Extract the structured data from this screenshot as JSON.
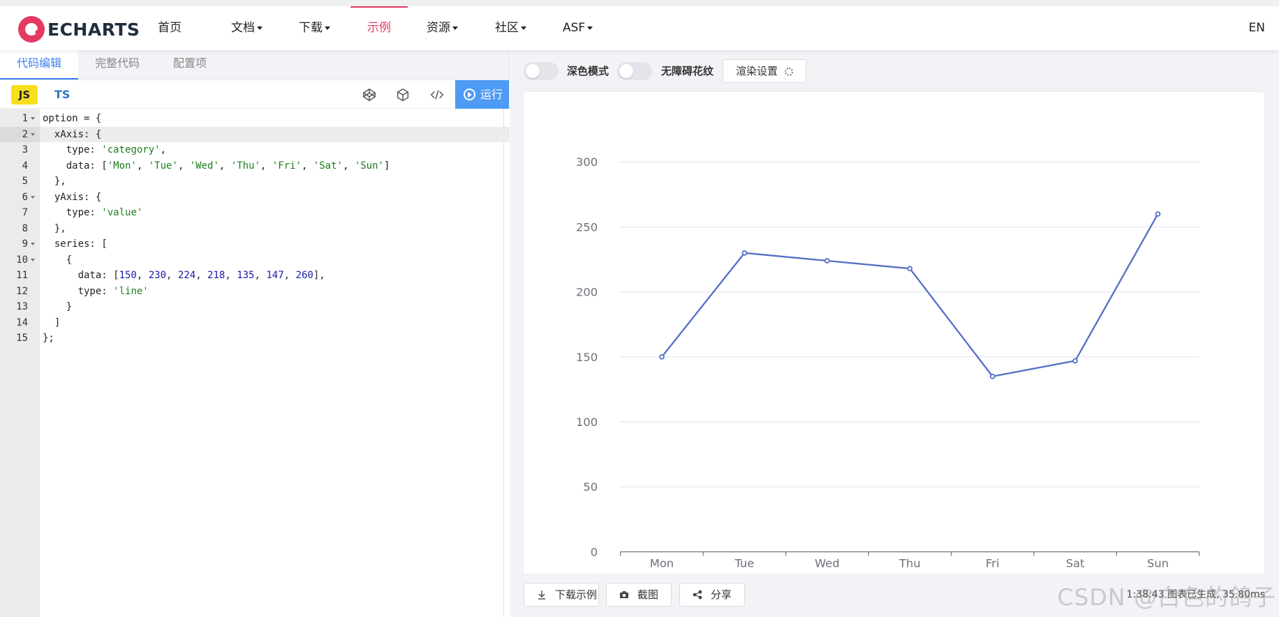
{
  "nav": {
    "logo_text": "ECHARTS",
    "items": [
      {
        "label": "首页",
        "dropdown": false,
        "active": false
      },
      {
        "label": "文档",
        "dropdown": true,
        "active": false
      },
      {
        "label": "下载",
        "dropdown": true,
        "active": false
      },
      {
        "label": "示例",
        "dropdown": false,
        "active": true
      },
      {
        "label": "资源",
        "dropdown": true,
        "active": false
      },
      {
        "label": "社区",
        "dropdown": true,
        "active": false
      },
      {
        "label": "ASF",
        "dropdown": true,
        "active": false
      }
    ],
    "lang": "EN",
    "accent_color": "#e43961"
  },
  "editor": {
    "tabs": [
      "代码编辑",
      "完整代码",
      "配置项"
    ],
    "active_tab": 0,
    "js_label": "JS",
    "ts_label": "TS",
    "tool_icons": [
      "codepen-icon",
      "codesandbox-icon",
      "embed-code-icon"
    ],
    "run_label": "运行",
    "current_line": 2,
    "lines": [
      {
        "n": "1",
        "fold": true,
        "html": "option = {"
      },
      {
        "n": "2",
        "fold": true,
        "html": "  xAxis: {"
      },
      {
        "n": "3",
        "fold": false,
        "html": "    type: <span class=\"s\">'category'</span>,"
      },
      {
        "n": "4",
        "fold": false,
        "html": "    data: [<span class=\"s\">'Mon'</span>, <span class=\"s\">'Tue'</span>, <span class=\"s\">'Wed'</span>, <span class=\"s\">'Thu'</span>, <span class=\"s\">'Fri'</span>, <span class=\"s\">'Sat'</span>, <span class=\"s\">'Sun'</span>]"
      },
      {
        "n": "5",
        "fold": false,
        "html": "  },"
      },
      {
        "n": "6",
        "fold": true,
        "html": "  yAxis: {"
      },
      {
        "n": "7",
        "fold": false,
        "html": "    type: <span class=\"s\">'value'</span>"
      },
      {
        "n": "8",
        "fold": false,
        "html": "  },"
      },
      {
        "n": "9",
        "fold": true,
        "html": "  series: ["
      },
      {
        "n": "10",
        "fold": true,
        "html": "    {"
      },
      {
        "n": "11",
        "fold": false,
        "html": "      data: [<span class=\"n\">150</span>, <span class=\"n\">230</span>, <span class=\"n\">224</span>, <span class=\"n\">218</span>, <span class=\"n\">135</span>, <span class=\"n\">147</span>, <span class=\"n\">260</span>],"
      },
      {
        "n": "12",
        "fold": false,
        "html": "      type: <span class=\"s\">'line'</span>"
      },
      {
        "n": "13",
        "fold": false,
        "html": "    }"
      },
      {
        "n": "14",
        "fold": false,
        "html": "  ]"
      },
      {
        "n": "15",
        "fold": false,
        "html": "};"
      }
    ]
  },
  "preview": {
    "dark_mode_label": "深色模式",
    "aria_label": "无障碍花纹",
    "render_settings_label": "渲染设置",
    "download_label": "下载示例",
    "screenshot_label": "截图",
    "share_label": "分享",
    "status": "1:38:43  图表已生成, 35.80ms",
    "watermark": "CSDN @白色的鸽子"
  },
  "chart_data": {
    "type": "line",
    "categories": [
      "Mon",
      "Tue",
      "Wed",
      "Thu",
      "Fri",
      "Sat",
      "Sun"
    ],
    "values": [
      150,
      230,
      224,
      218,
      135,
      147,
      260
    ],
    "ylim": [
      0,
      300
    ],
    "yticks": [
      0,
      50,
      100,
      150,
      200,
      250,
      300
    ],
    "grid": true,
    "line_color": "#5470c6",
    "title": "",
    "xlabel": "",
    "ylabel": ""
  }
}
